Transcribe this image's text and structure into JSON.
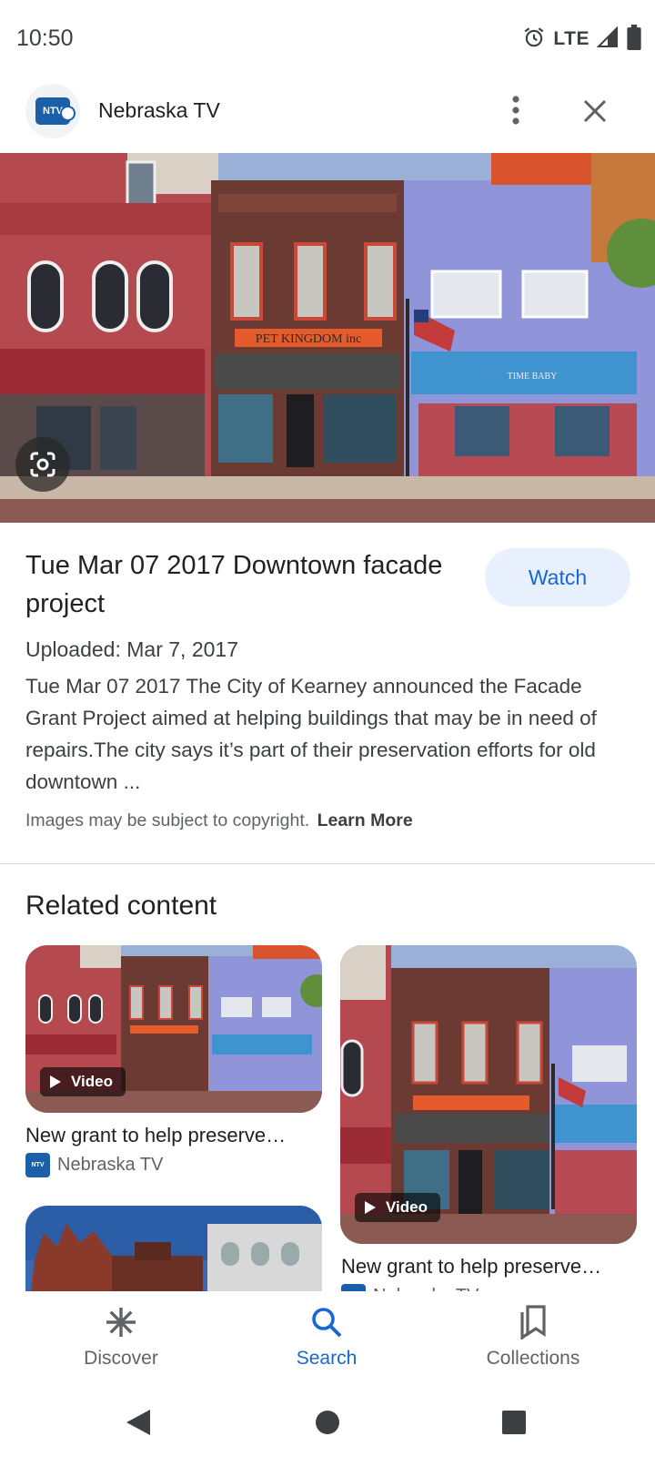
{
  "status_bar": {
    "time": "10:50",
    "network": "LTE",
    "icons": [
      "alarm-icon",
      "signal-icon",
      "battery-icon"
    ]
  },
  "header": {
    "source_name": "Nebraska TV",
    "logo_text": "NTV",
    "more_icon": "more-vert-icon",
    "close_icon": "close-icon"
  },
  "hero": {
    "signs": [
      "PET KINGDOM inc",
      "TIME BABY"
    ],
    "lens_icon": "google-lens-icon"
  },
  "details": {
    "title": "Tue Mar 07 2017 Downtown facade project",
    "watch_label": "Watch",
    "uploaded": "Uploaded: Mar 7, 2017",
    "description": "Tue Mar 07 2017 The City of Kearney announced the Facade Grant Project aimed at helping buildings that may be in need of repairs.The city says it’s part of their preservation efforts for old downtown ...",
    "copyright_text": "Images may be subject to copyright.",
    "learn_more_label": "Learn More"
  },
  "related": {
    "heading": "Related content",
    "items": [
      {
        "badge": "Video",
        "title": "New grant to help preserve…",
        "source": "Nebraska TV"
      },
      {
        "badge": "Video",
        "title": "New grant to help preserve…",
        "source": "Nebraska TV"
      },
      {
        "badge": "",
        "title": "",
        "source": ""
      }
    ]
  },
  "bottom_nav": {
    "items": [
      {
        "label": "Discover",
        "icon": "discover-asterisk-icon",
        "active": false
      },
      {
        "label": "Search",
        "icon": "search-icon",
        "active": true
      },
      {
        "label": "Collections",
        "icon": "collections-bookmark-icon",
        "active": false
      }
    ]
  },
  "colors": {
    "accent": "#1967d2",
    "watch_bg": "#e8f0fe",
    "text_primary": "#202124",
    "text_secondary": "#5f6368",
    "divider": "#dadce0"
  }
}
